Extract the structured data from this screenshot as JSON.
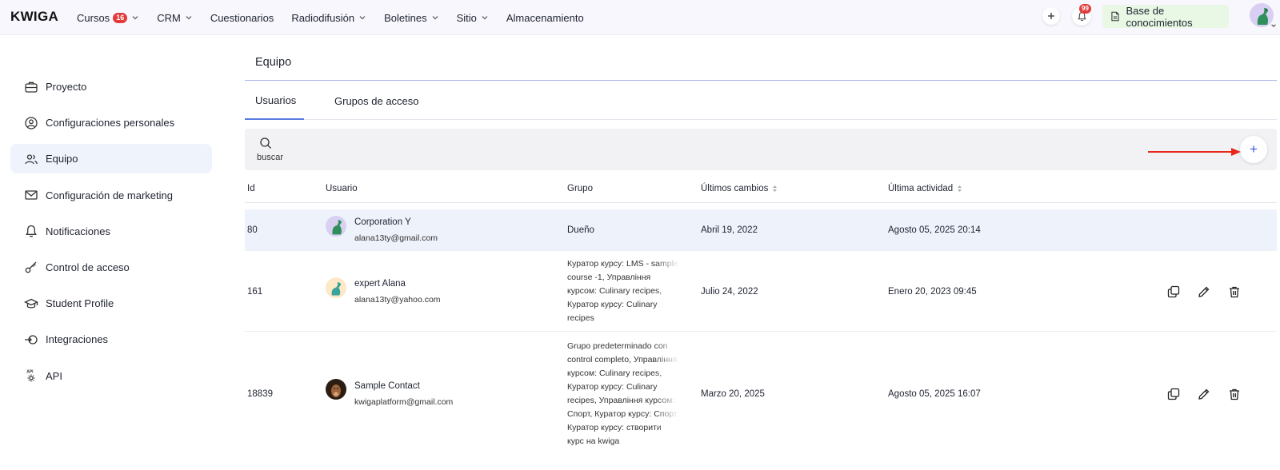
{
  "brand": "KWIGA",
  "nav": {
    "items": [
      {
        "label": "Cursos",
        "badge": "16",
        "dropdown": true
      },
      {
        "label": "CRM",
        "dropdown": true
      },
      {
        "label": "Cuestionarios",
        "dropdown": false
      },
      {
        "label": "Radiodifusión",
        "dropdown": true
      },
      {
        "label": "Boletines",
        "dropdown": true
      },
      {
        "label": "Sitio",
        "dropdown": true
      },
      {
        "label": "Almacenamiento",
        "dropdown": false
      }
    ],
    "notifications_badge": "99",
    "knowledge_base": "Base de conocimientos"
  },
  "sidebar": {
    "items": [
      {
        "label": "Proyecto",
        "icon": "briefcase-icon"
      },
      {
        "label": "Configuraciones personales",
        "icon": "user-circle-icon"
      },
      {
        "label": "Equipo",
        "icon": "users-icon",
        "active": true
      },
      {
        "label": "Configuración de marketing",
        "icon": "envelope-icon"
      },
      {
        "label": "Notificaciones",
        "icon": "bell-icon"
      },
      {
        "label": "Control de acceso",
        "icon": "key-icon"
      },
      {
        "label": "Student Profile",
        "icon": "graduation-cap-icon"
      },
      {
        "label": "Integraciones",
        "icon": "integrations-icon"
      },
      {
        "label": "API",
        "icon": "api-gear-icon"
      }
    ]
  },
  "main": {
    "title": "Equipo",
    "tabs": [
      {
        "label": "Usuarios",
        "active": true
      },
      {
        "label": "Grupos de acceso",
        "active": false
      }
    ],
    "search_label": "buscar",
    "add_button": "+",
    "table": {
      "headers": [
        "Id",
        "Usuario",
        "Grupo",
        "Últimos cambios",
        "Última actividad"
      ],
      "rows": [
        {
          "id": "80",
          "name": "Corporation Y",
          "email": "alana13ty@gmail.com",
          "group": "Dueño",
          "changed": "Abril 19, 2022",
          "activity": "Agosto 05, 2025 20:14",
          "highlighted": true
        },
        {
          "id": "161",
          "name": "expert Alana",
          "email": "alana13ty@yahoo.com",
          "group": "Куратор курсу: LMS - sample course -1, Управління курсом: Culinary recipes, Куратор курсу: Culinary recipes",
          "changed": "Julio 24, 2022",
          "activity": "Enero 20, 2023 09:45",
          "highlighted": false
        },
        {
          "id": "18839",
          "name": "Sample Contact",
          "email": "kwigaplatform@gmail.com",
          "group": "Grupo predeterminado con control completo, Управління курсом: Culinary recipes, Куратор курсу: Culinary recipes, Управління курсом: Спорт, Куратор курсу: Спорт, Куратор курсу: створити курс на kwiga",
          "changed": "Marzo 20, 2025",
          "activity": "Agosto 05, 2025 16:07",
          "highlighted": false
        }
      ]
    }
  },
  "colors": {
    "accent": "#3a5bd9",
    "badge": "#e23b3b",
    "highlight_row": "#eef2fb",
    "kb_button": "#e8f8e5",
    "arrow": "#e8261a"
  }
}
